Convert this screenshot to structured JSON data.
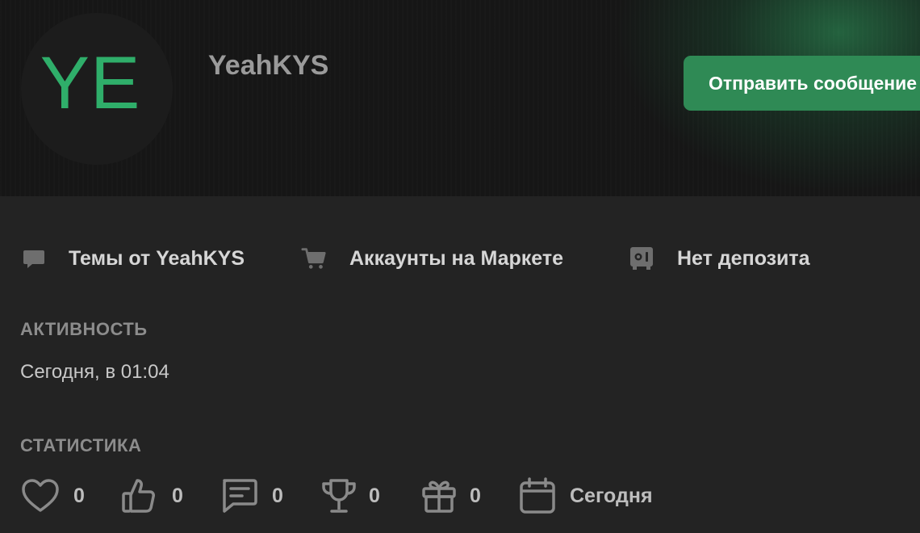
{
  "profile": {
    "avatar_initials": "YE",
    "username": "YeahKYS",
    "send_message_label": "Отправить сообщение"
  },
  "links": [
    {
      "label": "Темы от YeahKYS",
      "icon": "chat-bubble-icon"
    },
    {
      "label": "Аккаунты на Маркете",
      "icon": "cart-icon"
    },
    {
      "label": "Нет депозита",
      "icon": "safe-icon"
    }
  ],
  "activity": {
    "title": "АКТИВНОСТЬ",
    "value": "Сегодня, в 01:04"
  },
  "statistics": {
    "title": "СТАТИСТИКА",
    "items": [
      {
        "icon": "heart-icon",
        "value": "0"
      },
      {
        "icon": "thumbs-up-icon",
        "value": "0"
      },
      {
        "icon": "message-icon",
        "value": "0"
      },
      {
        "icon": "trophy-icon",
        "value": "0"
      },
      {
        "icon": "gift-icon",
        "value": "0"
      },
      {
        "icon": "calendar-icon",
        "value": "Сегодня"
      }
    ]
  },
  "colors": {
    "accent": "#2fae6a",
    "button": "#2f8a55",
    "background": "#232323",
    "header": "#161616"
  }
}
